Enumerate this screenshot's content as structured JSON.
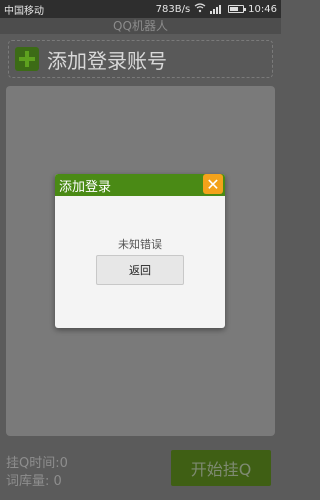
{
  "statusbar": {
    "carrier": "中国移动",
    "speed": "783B/s",
    "time": "10:46",
    "icons": [
      "wifi-icon",
      "signal-icon",
      "battery-icon"
    ]
  },
  "app": {
    "title": "QQ机器人"
  },
  "main": {
    "add_account_label": "添加登录账号",
    "add_icon": "plus-icon"
  },
  "footer": {
    "hang_time_label": "挂Q时间:0",
    "lexicon_label": "词库量:  0",
    "start_button_label": "开始挂Q"
  },
  "dialog": {
    "title": "添加登录",
    "close_icon": "close-icon",
    "message": "未知错误",
    "button_label": "返回"
  },
  "colors": {
    "accent_green": "#4a8a15",
    "close_orange": "#f3a21a"
  }
}
